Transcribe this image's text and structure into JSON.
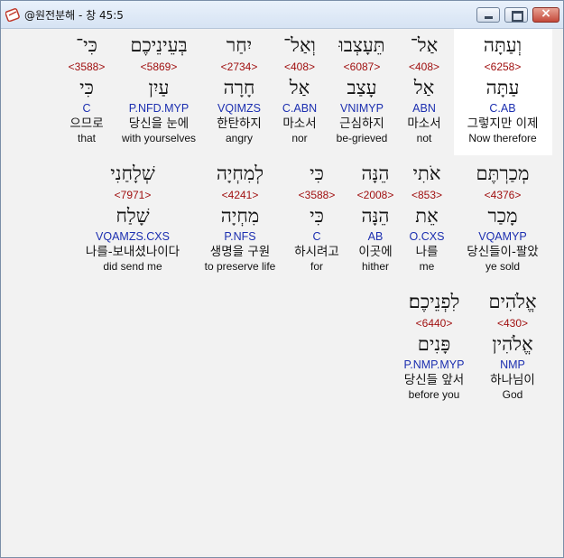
{
  "window": {
    "title": "@원전분해 - 창 45:5",
    "icon": "bible-app-icon",
    "controls": {
      "minimize": "minimize-icon",
      "maximize": "maximize-icon",
      "close": "×"
    }
  },
  "rows": [
    [
      {
        "heb": "וְעַתָּה",
        "strong": "<6258>",
        "lex": "עַתָּה",
        "parse": "C.AB",
        "kor": "그렇지만 이제",
        "eng": "Now therefore"
      },
      {
        "heb": "אַל־",
        "strong": "<408>",
        "lex": "אַל",
        "parse": "ABN",
        "kor": "마소서",
        "eng": "not"
      },
      {
        "heb": "תֵּעָצְבוּ",
        "strong": "<6087>",
        "lex": "עָצַב",
        "parse": "VNIMYP",
        "kor": "근심하지",
        "eng": "be-grieved"
      },
      {
        "heb": "וְאַל־",
        "strong": "<408>",
        "lex": "אַל",
        "parse": "C.ABN",
        "kor": "마소서",
        "eng": "nor"
      },
      {
        "heb": "יִחַר",
        "strong": "<2734>",
        "lex": "חָרָה",
        "parse": "VQIMZS",
        "kor": "한탄하지",
        "eng": "angry"
      },
      {
        "heb": "בְּעֵינֵיכֶם",
        "strong": "<5869>",
        "lex": "עַיִן",
        "parse": "P.NFD.MYP",
        "kor": "당신을 눈에",
        "eng": "with yourselves"
      },
      {
        "heb": "כִּי־",
        "strong": "<3588>",
        "lex": "כִּי",
        "parse": "C",
        "kor": "으므로",
        "eng": "that"
      }
    ],
    [
      {
        "heb": "מְכַרְתֶּם",
        "strong": "<4376>",
        "lex": "מָכַר",
        "parse": "VQAMYP",
        "kor": "당신들이-팔았",
        "eng": "ye sold"
      },
      {
        "heb": "אֹתִי",
        "strong": "<853>",
        "lex": "אֵת",
        "parse": "O.CXS",
        "kor": "나를",
        "eng": "me"
      },
      {
        "heb": "הֵנָּה",
        "strong": "<2008>",
        "lex": "הֵנָּה",
        "parse": "AB",
        "kor": "이곳에",
        "eng": "hither"
      },
      {
        "heb": "כִּי",
        "strong": "<3588>",
        "lex": "כִּי",
        "parse": "C",
        "kor": "하시려고",
        "eng": "for"
      },
      {
        "heb": "לְמִחְיָה",
        "strong": "<4241>",
        "lex": "מִחְיָה",
        "parse": "P.NFS",
        "kor": "생명을 구원",
        "eng": "to preserve life"
      },
      {
        "heb": "שְׁלָחַנִי",
        "strong": "<7971>",
        "lex": "שָׁלַח",
        "parse": "VQAMZS.CXS",
        "kor": "나를-보내셨나이다",
        "eng": "did send me"
      }
    ],
    [
      {
        "heb": "אֱלֹהִים",
        "strong": "<430>",
        "lex": "אֱלֹהִין",
        "parse": "NMP",
        "kor": "하나님이",
        "eng": "God"
      },
      {
        "heb": "לִפְנֵיכֶם׃",
        "strong": "<6440>",
        "lex": "פָּנִים",
        "parse": "P.NMP.MYP",
        "kor": "당신들 앞서",
        "eng": "before you"
      }
    ]
  ]
}
